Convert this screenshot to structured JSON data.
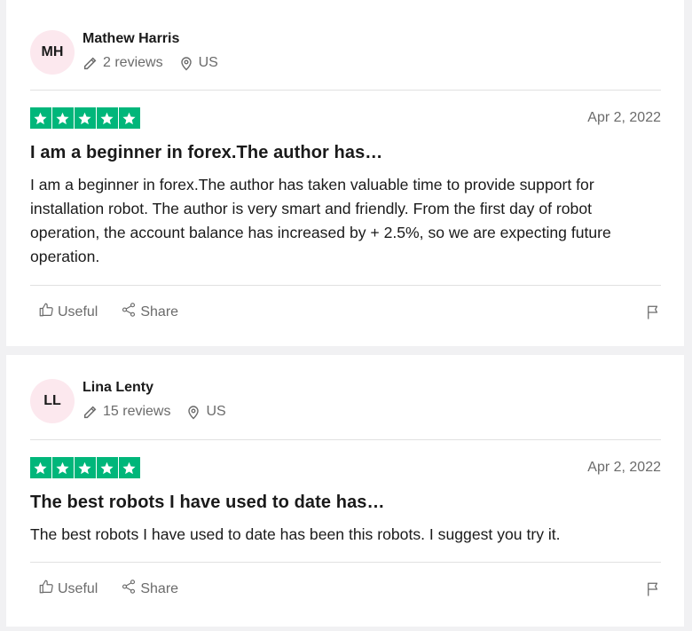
{
  "reviews": [
    {
      "initials": "MH",
      "name": "Mathew Harris",
      "reviews_count": "2 reviews",
      "country": "US",
      "rating": 5,
      "date": "Apr 2, 2022",
      "title": "I am a beginner in forex.The author has…",
      "body": "I am a beginner in forex.The author has taken valuable time to provide support for installation robot. The author is very smart and friendly. From the first day of robot operation, the account balance has increased by + 2.5%, so we are expecting future operation.",
      "useful_label": "Useful",
      "share_label": "Share"
    },
    {
      "initials": "LL",
      "name": "Lina Lenty",
      "reviews_count": "15 reviews",
      "country": "US",
      "rating": 5,
      "date": "Apr 2, 2022",
      "title": "The best robots I have used to date has…",
      "body": "The best robots I have used to date has been this robots. I suggest you try it.",
      "useful_label": "Useful",
      "share_label": "Share"
    }
  ],
  "colors": {
    "star_green": "#00b67a",
    "avatar_bg": "#fce8ee",
    "muted_text": "#6b6b6b"
  },
  "icons": {
    "pencil": "pencil-icon",
    "location": "location-pin-icon",
    "star": "star-icon",
    "thumbs_up": "thumbs-up-icon",
    "share": "share-icon",
    "flag": "flag-icon"
  }
}
